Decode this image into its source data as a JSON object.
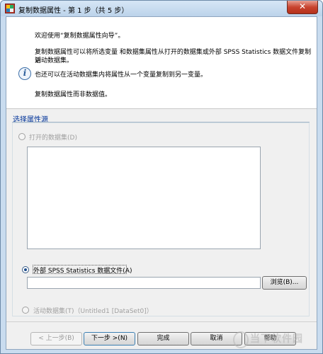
{
  "window": {
    "title": "复制数据属性 - 第 1 步（共 5 步）",
    "close_glyph": "✕"
  },
  "intro": {
    "welcome": "欢迎使用“复制数据属性向导”。",
    "desc_line1": "复制数据属性可以将所选变量 和数据集属性从打开的数据集或外部 SPSS Statistics 数据文件复制到",
    "desc_line2": "活动数据集。",
    "info": "也还可以在活动数据集内将属性从一个变量复制到另一变量。",
    "note": "复制数据属性而非数据值。"
  },
  "source_group": {
    "title": "选择属性源",
    "open_dataset_label": "打开的数据集(D)",
    "external_file_label": "外部 SPSS Statistics 数据文件(A)",
    "external_file_path": "",
    "browse_label": "浏览(B)...",
    "active_dataset_label": "活动数据集(T)（Untitled1 [DataSet0]）",
    "selected": "external_file"
  },
  "buttons": {
    "back": "< 上一步(B)",
    "next": "下一步 >(N)",
    "finish": "完成",
    "cancel": "取消",
    "help": "帮助"
  },
  "watermark": {
    "text": "当下软件园"
  }
}
